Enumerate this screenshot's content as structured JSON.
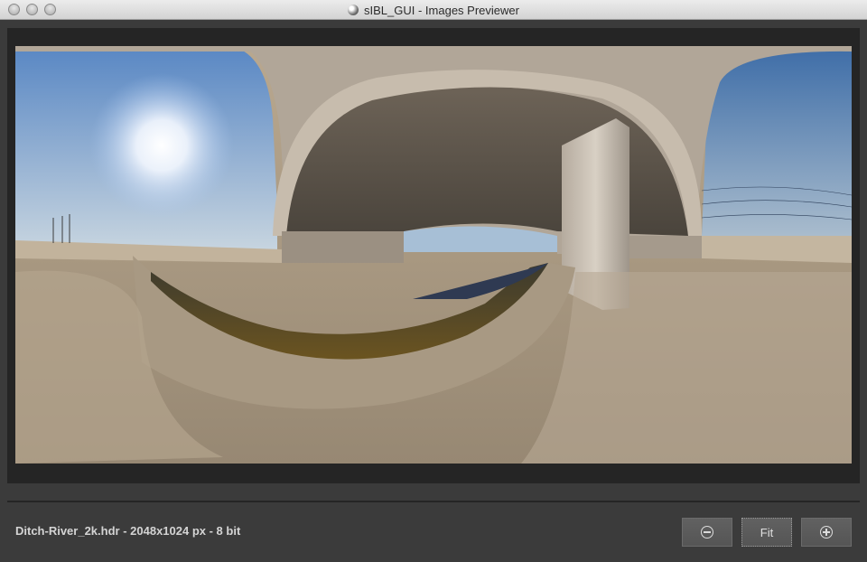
{
  "window": {
    "title": "sIBL_GUI - Images Previewer"
  },
  "image_info": "Ditch-River_2k.hdr - 2048x1024 px - 8 bit",
  "buttons": {
    "zoom_out_icon": "minus-circle-icon",
    "fit_label": "Fit",
    "zoom_in_icon": "plus-circle-icon"
  },
  "colors": {
    "window_bg": "#3b3b3b",
    "viewer_bg": "#252525",
    "text": "#d4d4d4"
  }
}
